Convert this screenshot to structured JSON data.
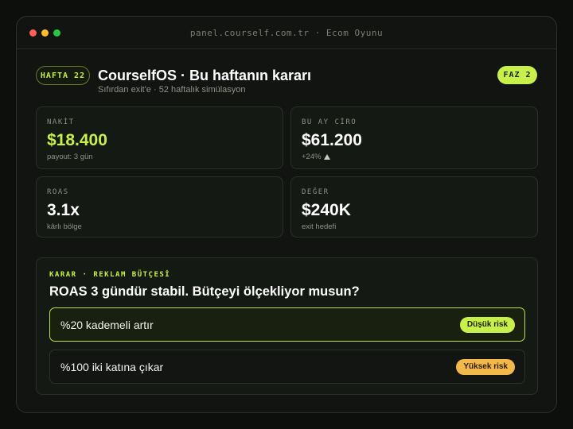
{
  "window": {
    "url": "panel.courself.com.tr · Ecom Oyunu"
  },
  "header": {
    "week_badge": "HAFTA 22",
    "title": "CourselfOS · Bu haftanın kararı",
    "subtitle": "Sıfırdan exit'e · 52 haftalık simülasyon",
    "phase_badge": "FAZ 2"
  },
  "stats": [
    {
      "label": "NAKİT",
      "value": "$18.400",
      "note": "payout: 3 gün"
    },
    {
      "label": "BU AY CİRO",
      "value": "$61.200",
      "note": "+24%"
    },
    {
      "label": "ROAS",
      "value": "3.1x",
      "note": "kârlı bölge"
    },
    {
      "label": "DEĞER",
      "value": "$240K",
      "note": "exit hedefi"
    }
  ],
  "decision": {
    "kicker": "KARAR · REKLAM BÜTÇESİ",
    "question": "ROAS 3 gündür stabil. Bütçeyi ölçekliyor musun?",
    "options": [
      {
        "label": "%20 kademeli artır",
        "risk": "Düşük risk",
        "selected": true
      },
      {
        "label": "%100 iki katına çıkar",
        "risk": "Yüksek risk",
        "selected": false
      }
    ]
  },
  "colors": {
    "accent": "#c8f04a",
    "high_risk": "#f2b84a",
    "background": "#0d0f0c"
  },
  "icons": {
    "trend": "up-triangle-icon"
  }
}
